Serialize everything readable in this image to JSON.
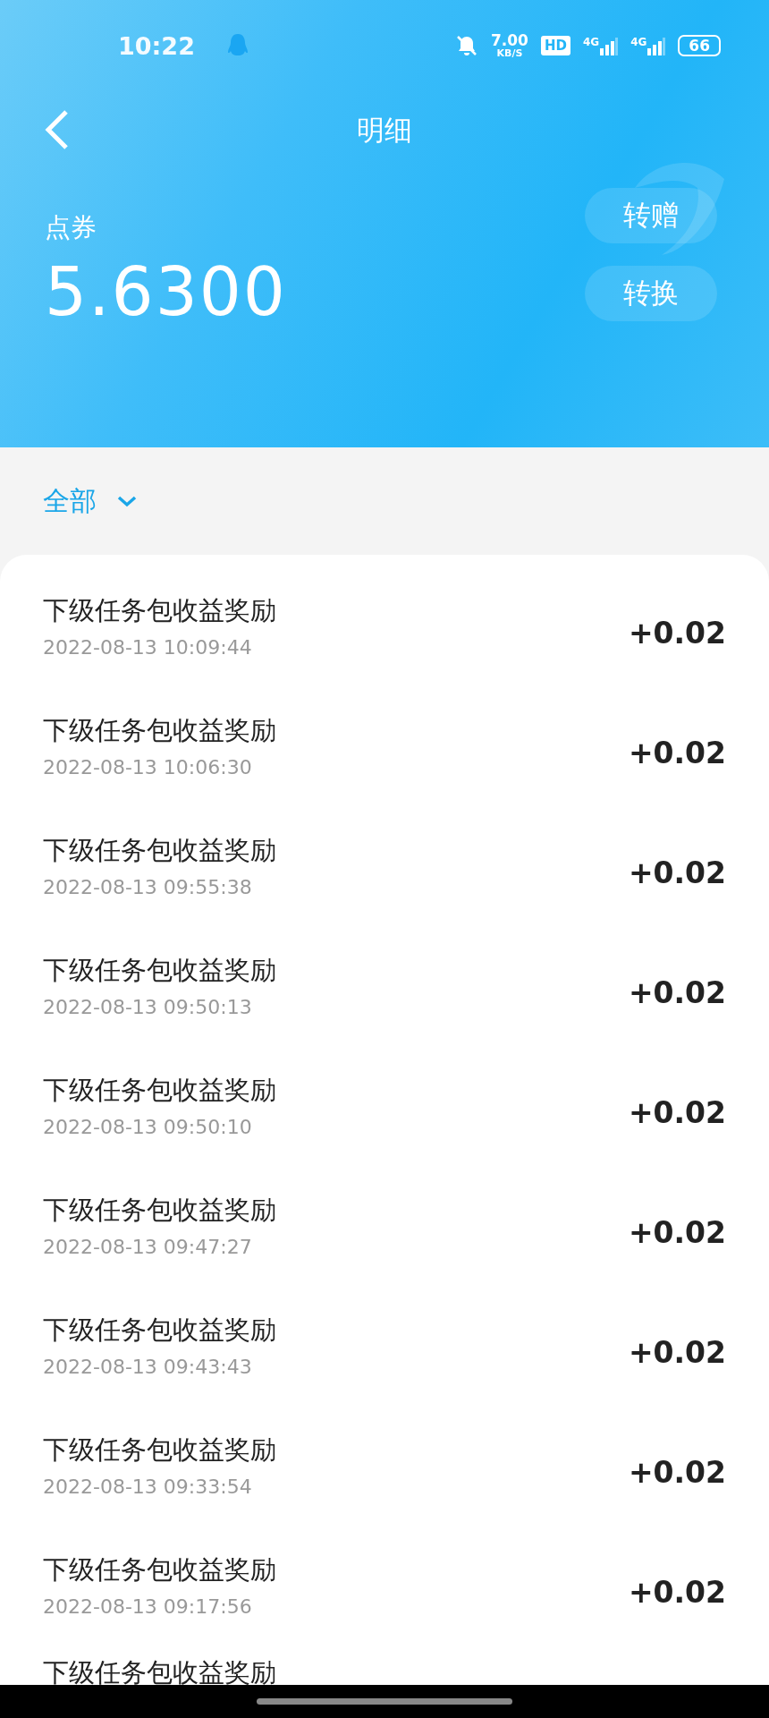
{
  "status_bar": {
    "time": "10:22",
    "speed_value": "7.00",
    "speed_unit": "KB/S",
    "hd": "HD",
    "network_1": "4G",
    "network_2": "4G",
    "battery": "66"
  },
  "nav": {
    "title": "明细"
  },
  "balance": {
    "label": "点券",
    "amount": "5.6300",
    "actions": [
      "转赠",
      "转换"
    ]
  },
  "filter": {
    "label": "全部"
  },
  "records": [
    {
      "title": "下级任务包收益奖励",
      "time": "2022-08-13 10:09:44",
      "amount": "+0.02"
    },
    {
      "title": "下级任务包收益奖励",
      "time": "2022-08-13 10:06:30",
      "amount": "+0.02"
    },
    {
      "title": "下级任务包收益奖励",
      "time": "2022-08-13 09:55:38",
      "amount": "+0.02"
    },
    {
      "title": "下级任务包收益奖励",
      "time": "2022-08-13 09:50:13",
      "amount": "+0.02"
    },
    {
      "title": "下级任务包收益奖励",
      "time": "2022-08-13 09:50:10",
      "amount": "+0.02"
    },
    {
      "title": "下级任务包收益奖励",
      "time": "2022-08-13 09:47:27",
      "amount": "+0.02"
    },
    {
      "title": "下级任务包收益奖励",
      "time": "2022-08-13 09:43:43",
      "amount": "+0.02"
    },
    {
      "title": "下级任务包收益奖励",
      "time": "2022-08-13 09:33:54",
      "amount": "+0.02"
    },
    {
      "title": "下级任务包收益奖励",
      "time": "2022-08-13 09:17:56",
      "amount": "+0.02"
    }
  ],
  "partial_record": {
    "title": "下级任务包收益奖励"
  }
}
